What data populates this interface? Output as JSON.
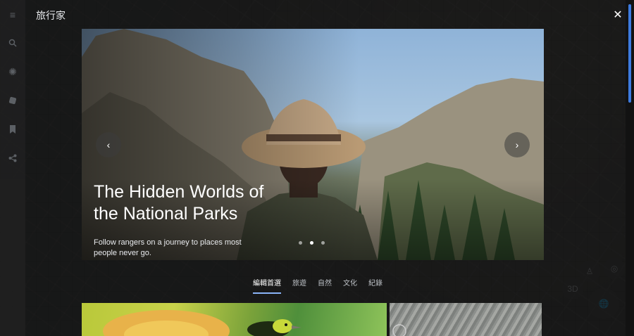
{
  "app": {
    "title": "旅行家"
  },
  "rail": {
    "icons": [
      "menu-icon",
      "search-icon",
      "voyager-icon",
      "dice-icon",
      "bookmark-icon",
      "share-icon"
    ]
  },
  "hero": {
    "title": "The Hidden Worlds of the National Parks",
    "subtitle": "Follow rangers on a journey to places most people never go.",
    "prev_glyph": "‹",
    "next_glyph": "›",
    "slides": 3,
    "active_slide": 2
  },
  "tabs": [
    {
      "label": "編輯首選",
      "active": true
    },
    {
      "label": "旅遊",
      "active": false
    },
    {
      "label": "自然",
      "active": false
    },
    {
      "label": "文化",
      "active": false
    },
    {
      "label": "紀錄",
      "active": false
    }
  ],
  "map_controls": {
    "view_3d": "3D"
  },
  "close_glyph": "✕",
  "colors": {
    "accent": "#8ab4f8",
    "scrollbar": "#3d7be0"
  }
}
